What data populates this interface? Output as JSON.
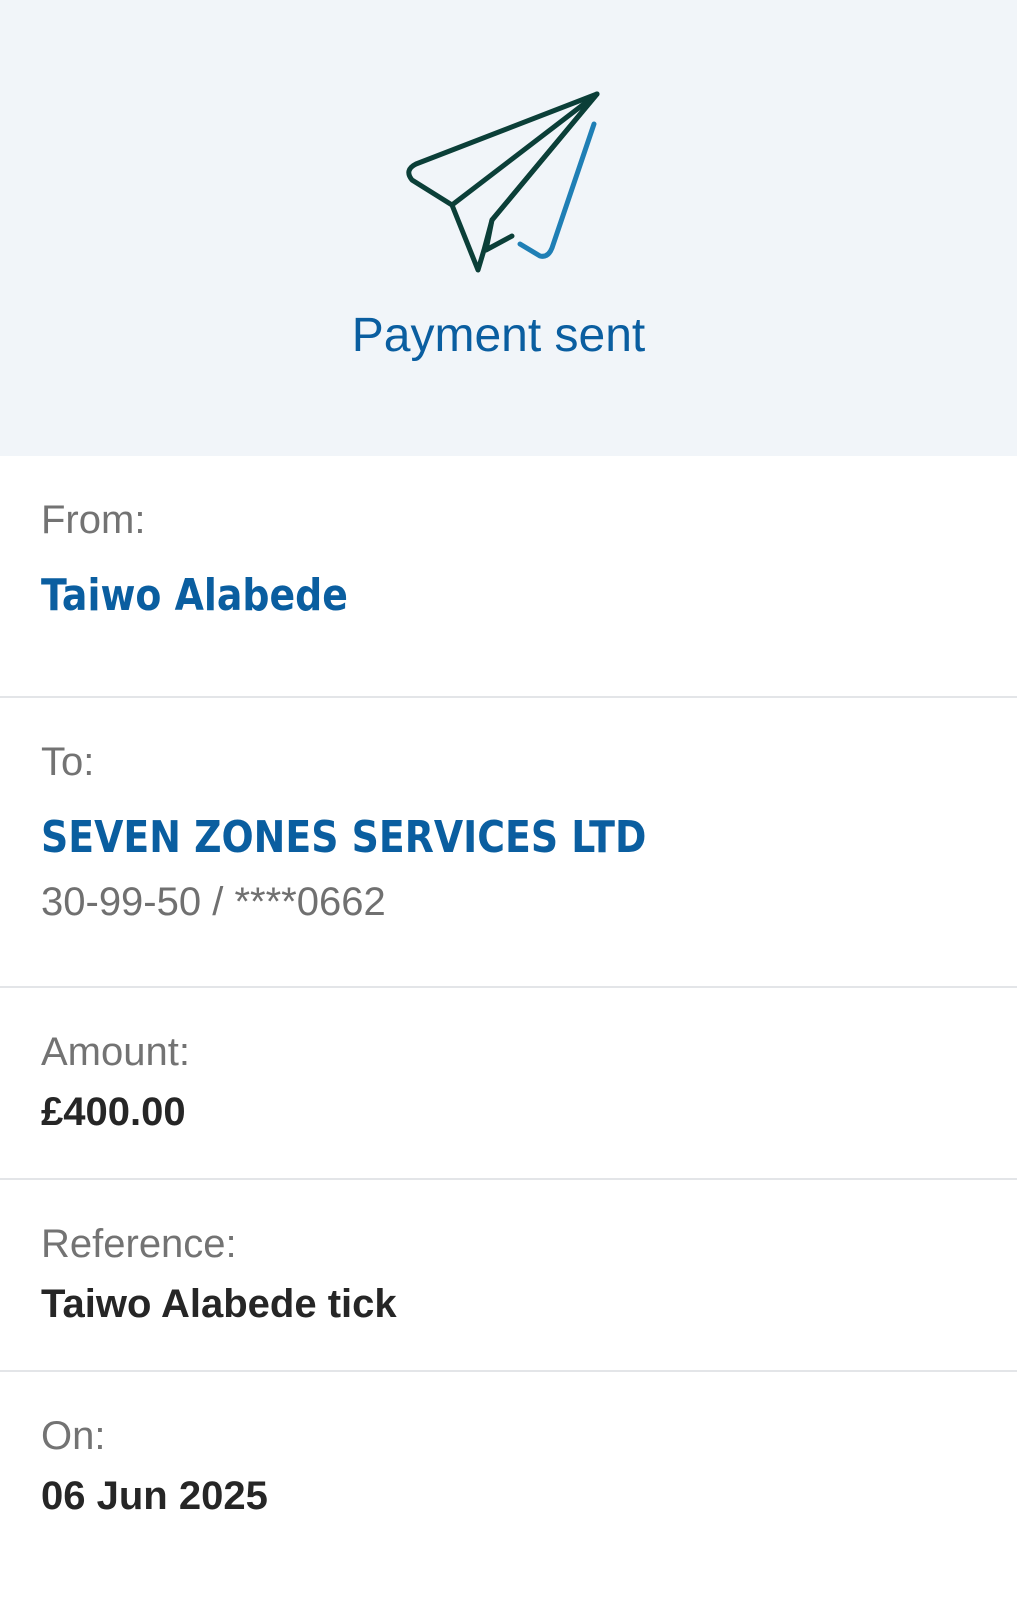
{
  "header": {
    "icon": "paper-plane-check-icon",
    "title": "Payment sent",
    "colors": {
      "background": "#f1f5f9",
      "accent": "#0a5ea0",
      "icon_dark": "#0b3f38",
      "icon_light": "#1f7fb5"
    }
  },
  "from": {
    "label": "From:",
    "name": "Taiwo Alabede"
  },
  "to": {
    "label": "To:",
    "name": "SEVEN ZONES SERVICES LTD",
    "account": "30-99-50 / ****0662"
  },
  "amount": {
    "label": "Amount:",
    "value": "£400.00"
  },
  "reference": {
    "label": "Reference:",
    "value": "Taiwo Alabede tick"
  },
  "date": {
    "label": "On:",
    "value": "06 Jun 2025"
  }
}
